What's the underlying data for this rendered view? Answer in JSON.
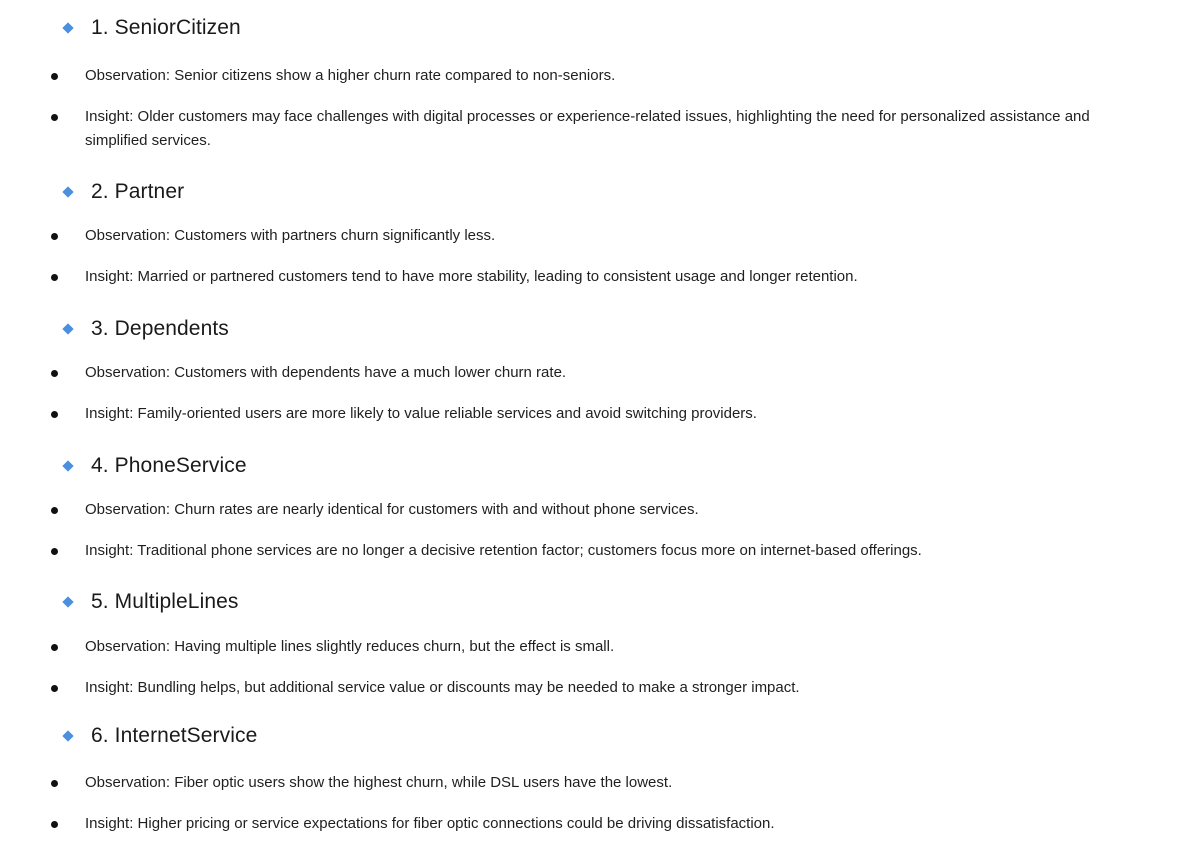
{
  "sections": [
    {
      "heading": "1. SeniorCitizen",
      "observation": "Observation: Senior citizens show a higher churn rate compared to non-seniors.",
      "insight": "Insight: Older customers may face challenges with digital processes or experience-related issues, highlighting the need for personalized assistance and simplified services."
    },
    {
      "heading": "2. Partner",
      "observation": "Observation: Customers with partners churn significantly less.",
      "insight": "Insight: Married or partnered customers tend to have more stability, leading to consistent usage and longer retention."
    },
    {
      "heading": "3. Dependents",
      "observation": "Observation: Customers with dependents have a much lower churn rate.",
      "insight": "Insight: Family-oriented users are more likely to value reliable services and avoid switching providers."
    },
    {
      "heading": "4. PhoneService",
      "observation": "Observation: Churn rates are nearly identical for customers with and without phone services.",
      "insight": "Insight: Traditional phone services are no longer a decisive retention factor; customers focus more on internet-based offerings."
    },
    {
      "heading": "5. MultipleLines",
      "observation": "Observation: Having multiple lines slightly reduces churn, but the effect is small.",
      "insight": "Insight: Bundling helps, but additional service value or discounts may be needed to make a stronger impact."
    },
    {
      "heading": "6. InternetService",
      "observation": "Observation: Fiber optic users show the highest churn, while DSL users have the lowest.",
      "insight": "Insight: Higher pricing or service expectations for fiber optic connections could be driving dissatisfaction."
    }
  ],
  "colors": {
    "diamond_icon": "#4a8fe0",
    "bullet": "#111111",
    "text": "#1f1f1f"
  }
}
